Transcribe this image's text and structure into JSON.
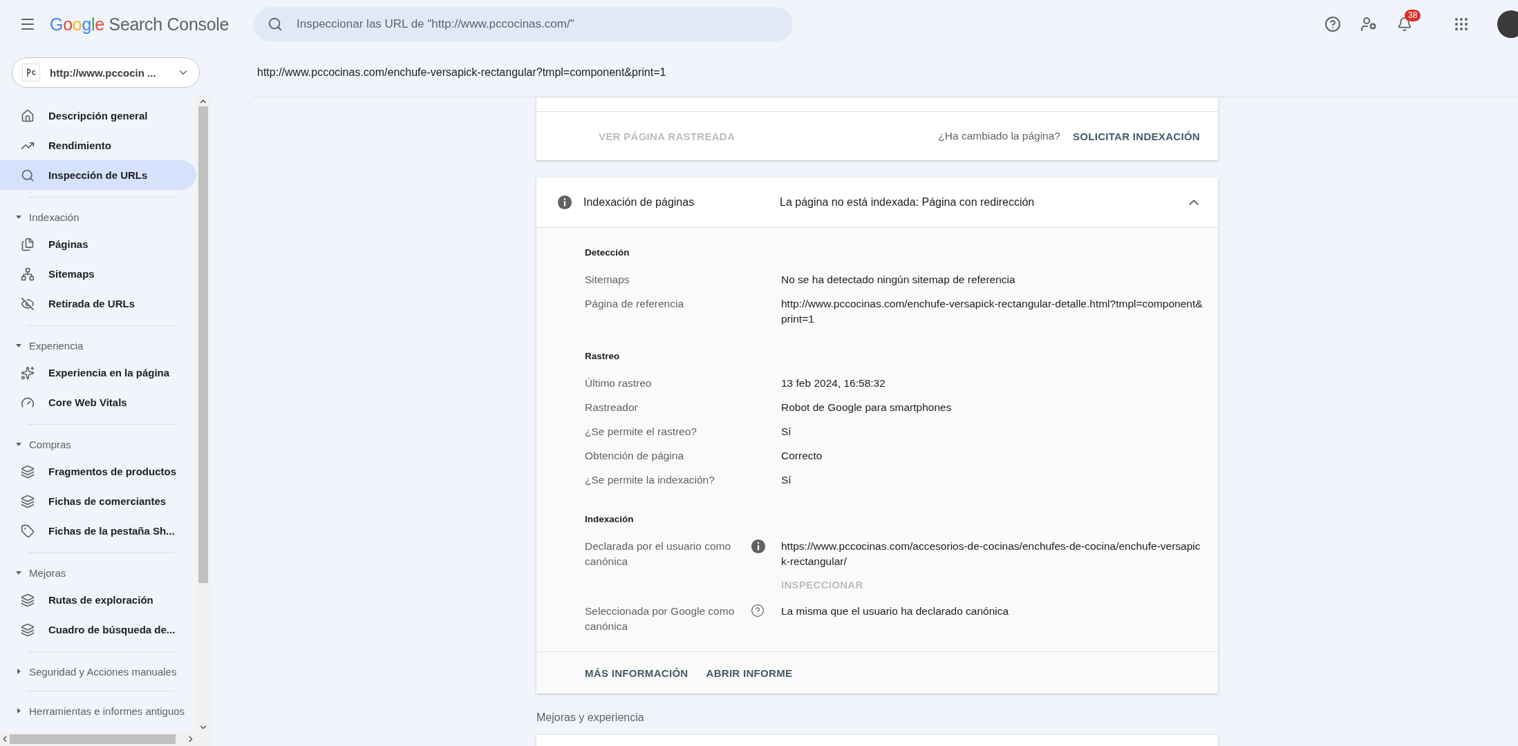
{
  "app_title": {
    "brand": "Google",
    "product": "Search Console"
  },
  "search": {
    "placeholder": "Inspeccionar las URL de \"http://www.pccocinas.com/\""
  },
  "notifications": {
    "count": "38"
  },
  "property": {
    "label": "http://www.pccocin ..."
  },
  "sidebar": {
    "sections": [
      {
        "items": [
          {
            "label": "Descripción general",
            "selected": false
          },
          {
            "label": "Rendimiento",
            "selected": false
          },
          {
            "label": "Inspección de URLs",
            "selected": true
          }
        ]
      },
      {
        "title": "Indexación",
        "expanded": true,
        "items": [
          {
            "label": "Páginas",
            "selected": false
          },
          {
            "label": "Sitemaps",
            "selected": false
          },
          {
            "label": "Retirada de URLs",
            "selected": false
          }
        ]
      },
      {
        "title": "Experiencia",
        "expanded": true,
        "items": [
          {
            "label": "Experiencia en la página",
            "selected": false
          },
          {
            "label": "Core Web Vitals",
            "selected": false
          }
        ]
      },
      {
        "title": "Compras",
        "expanded": true,
        "items": [
          {
            "label": "Fragmentos de productos",
            "selected": false
          },
          {
            "label": "Fichas de comerciantes",
            "selected": false
          },
          {
            "label": "Fichas de la pestaña Sh...",
            "selected": false
          }
        ]
      },
      {
        "title": "Mejoras",
        "expanded": true,
        "items": [
          {
            "label": "Rutas de exploración",
            "selected": false
          },
          {
            "label": "Cuadro de búsqueda de...",
            "selected": false
          }
        ]
      },
      {
        "title": "Seguridad y Acciones manuales",
        "expanded": false
      },
      {
        "title": "Herramientas e informes antiguos",
        "expanded": false
      }
    ]
  },
  "inspected_url": "http://www.pccocinas.com/enchufe-versapick-rectangular?tmpl=component&print=1",
  "top_card": {
    "view_button": {
      "label": "VER PÁGINA RASTREADA",
      "disabled": true
    },
    "changed_prompt": "¿Ha cambiado la página?",
    "request_button": {
      "label": "SOLICITAR INDEXACIÓN",
      "disabled": false
    }
  },
  "indexing_card": {
    "title": "Indexación de páginas",
    "status": "La página no está indexada: Página con redirección",
    "expanded": true,
    "sections": [
      {
        "heading": "Detección",
        "rows": [
          {
            "kind": "plain",
            "label": "Sitemaps",
            "value": "No se ha detectado ningún sitemap de referencia"
          },
          {
            "kind": "plain",
            "label": "Página de referencia",
            "value": "http://www.pccocinas.com/enchufe-versapick-rectangular-detalle.html?tmpl=component&print=1"
          }
        ]
      },
      {
        "heading": "Rastreo",
        "rows": [
          {
            "kind": "plain",
            "label": "Último rastreo",
            "value": "13 feb 2024, 16:58:32"
          },
          {
            "kind": "plain",
            "label": "Rastreador",
            "value": "Robot de Google para smartphones"
          },
          {
            "kind": "plain",
            "label": "¿Se permite el rastreo?",
            "value": "Sí"
          },
          {
            "kind": "plain",
            "label": "Obtención de página",
            "value": "Correcto"
          },
          {
            "kind": "plain",
            "label": "¿Se permite la indexación?",
            "value": "Sí"
          }
        ]
      },
      {
        "heading": "Indexación",
        "rows": [
          {
            "kind": "info",
            "label": "Declarada por el usuario como canónica",
            "value": "https://www.pccocinas.com/accesorios-de-cocinas/enchufes-de-cocina/enchufe-versapick-rectangular/",
            "action": {
              "label": "INSPECCIONAR",
              "disabled": true
            }
          },
          {
            "kind": "help",
            "label": "Seleccionada por Google como canónica",
            "value": "La misma que el usuario ha declarado canónica"
          }
        ]
      }
    ],
    "footer_buttons": [
      "MÁS INFORMACIÓN",
      "ABRIR INFORME"
    ]
  },
  "next_section_title": "Mejoras y experiencia"
}
